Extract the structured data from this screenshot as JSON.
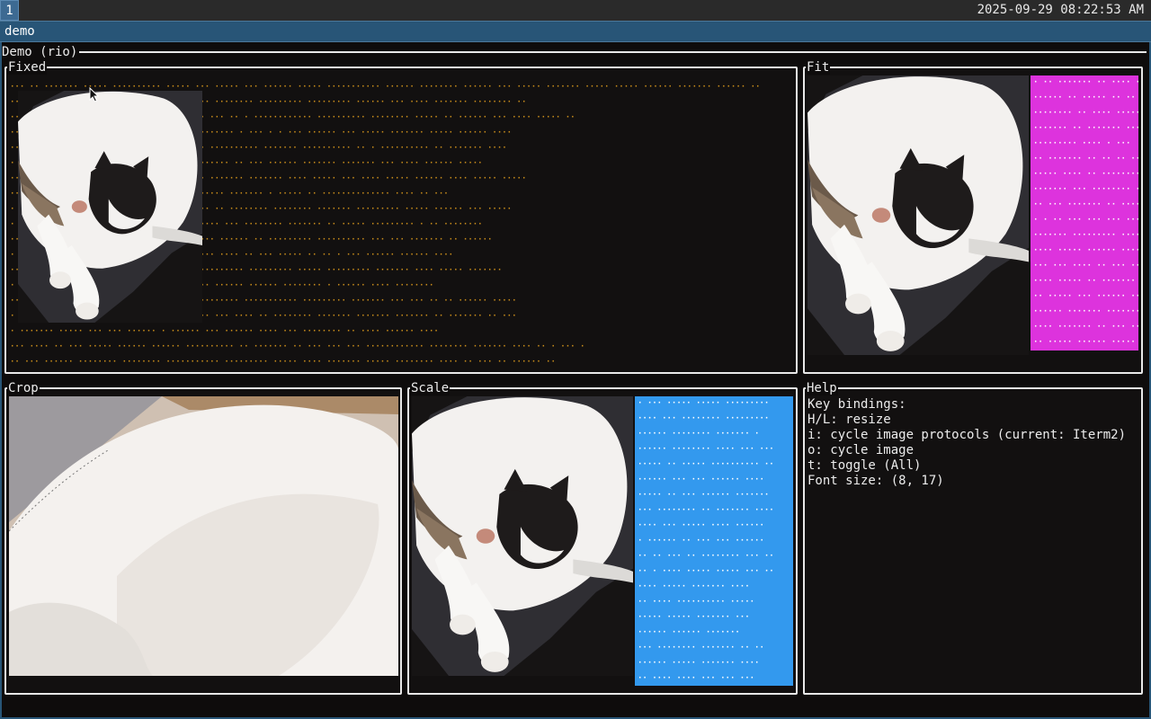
{
  "taskbar": {
    "workspace": "1",
    "clock": "2025-09-29 08:22:53 AM"
  },
  "window": {
    "title": "demo"
  },
  "app": {
    "title": "Demo (rio)"
  },
  "panes": {
    "fixed": "Fixed",
    "fit": "Fit",
    "crop": "Crop",
    "scale": "Scale",
    "help": "Help"
  },
  "help": {
    "lines": [
      "Key bindings:",
      "H/L: resize",
      "i: cycle image protocols (current: Iterm2)",
      "o: cycle image",
      "t: toggle (All)",
      "Font size: (8, 17)"
    ]
  },
  "colors": {
    "accent": "#285577",
    "fixed_text": "#c98d1b",
    "fit_fill": "#dd33dd",
    "scale_fill": "#3399ee"
  },
  "icons": {
    "cursor": "mouse-pointer-icon"
  }
}
